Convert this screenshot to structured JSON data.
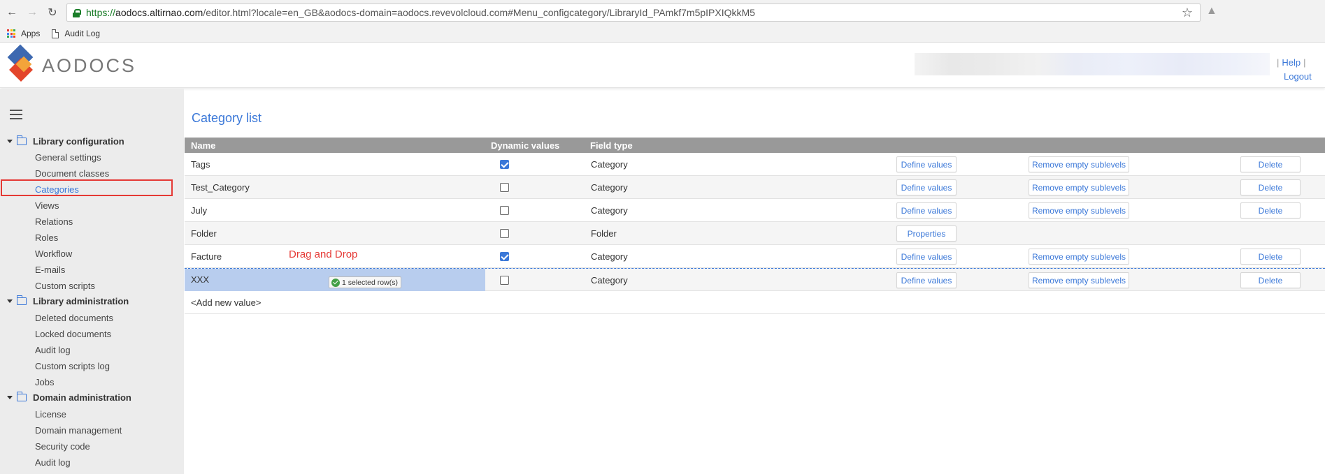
{
  "browser": {
    "url_proto": "https://",
    "url_host": "aodocs.altirnao.com",
    "url_rest": "/editor.html?locale=en_GB&aodocs-domain=aodocs.revevolcloud.com#Menu_configcategory/LibraryId_PAmkf7m5pIPXIQkkM5",
    "bookmarks": [
      "Apps",
      "Audit Log"
    ],
    "icons": [
      "back-arrow-icon",
      "forward-arrow-icon",
      "reload-icon",
      "lock-icon",
      "star-icon"
    ]
  },
  "header": {
    "logo_text": "AODOCS",
    "help": "Help",
    "logout": "Logout"
  },
  "sidebar": {
    "sections": [
      {
        "label": "Library configuration",
        "items": [
          "General settings",
          "Document classes",
          "Categories",
          "Views",
          "Relations",
          "Roles",
          "Workflow",
          "E-mails",
          "Custom scripts"
        ]
      },
      {
        "label": "Library administration",
        "items": [
          "Deleted documents",
          "Locked documents",
          "Audit log",
          "Custom scripts log",
          "Jobs"
        ]
      },
      {
        "label": "Domain administration",
        "items": [
          "License",
          "Domain management",
          "Security code",
          "Audit log"
        ]
      }
    ],
    "active_item": "Categories"
  },
  "main": {
    "title": "Category list",
    "columns": [
      "Name",
      "Dynamic values",
      "Field type"
    ],
    "rows": [
      {
        "name": "Tags",
        "dynamic": true,
        "type": "Category",
        "actions": [
          "Define values",
          "Remove empty sublevels",
          "Delete"
        ]
      },
      {
        "name": "Test_Category",
        "dynamic": false,
        "type": "Category",
        "actions": [
          "Define values",
          "Remove empty sublevels",
          "Delete"
        ]
      },
      {
        "name": "July",
        "dynamic": false,
        "type": "Category",
        "actions": [
          "Define values",
          "Remove empty sublevels",
          "Delete"
        ]
      },
      {
        "name": "Folder",
        "dynamic": false,
        "type": "Folder",
        "actions": [
          "Properties"
        ]
      },
      {
        "name": "Facture",
        "dynamic": true,
        "type": "Category",
        "actions": [
          "Define values",
          "Remove empty sublevels",
          "Delete"
        ]
      },
      {
        "name": "XXX",
        "dynamic": false,
        "type": "Category",
        "actions": [
          "Define values",
          "Remove empty sublevels",
          "Delete"
        ]
      }
    ],
    "add_new": "<Add new value>",
    "drag_annotation": "Drag and Drop",
    "drag_badge": "1 selected row(s)"
  },
  "colors": {
    "accent": "#3b78d8",
    "header_gray": "#999999",
    "sidebar_bg": "#ececec",
    "highlight": "#e53935",
    "selection": "#b8cdee"
  }
}
